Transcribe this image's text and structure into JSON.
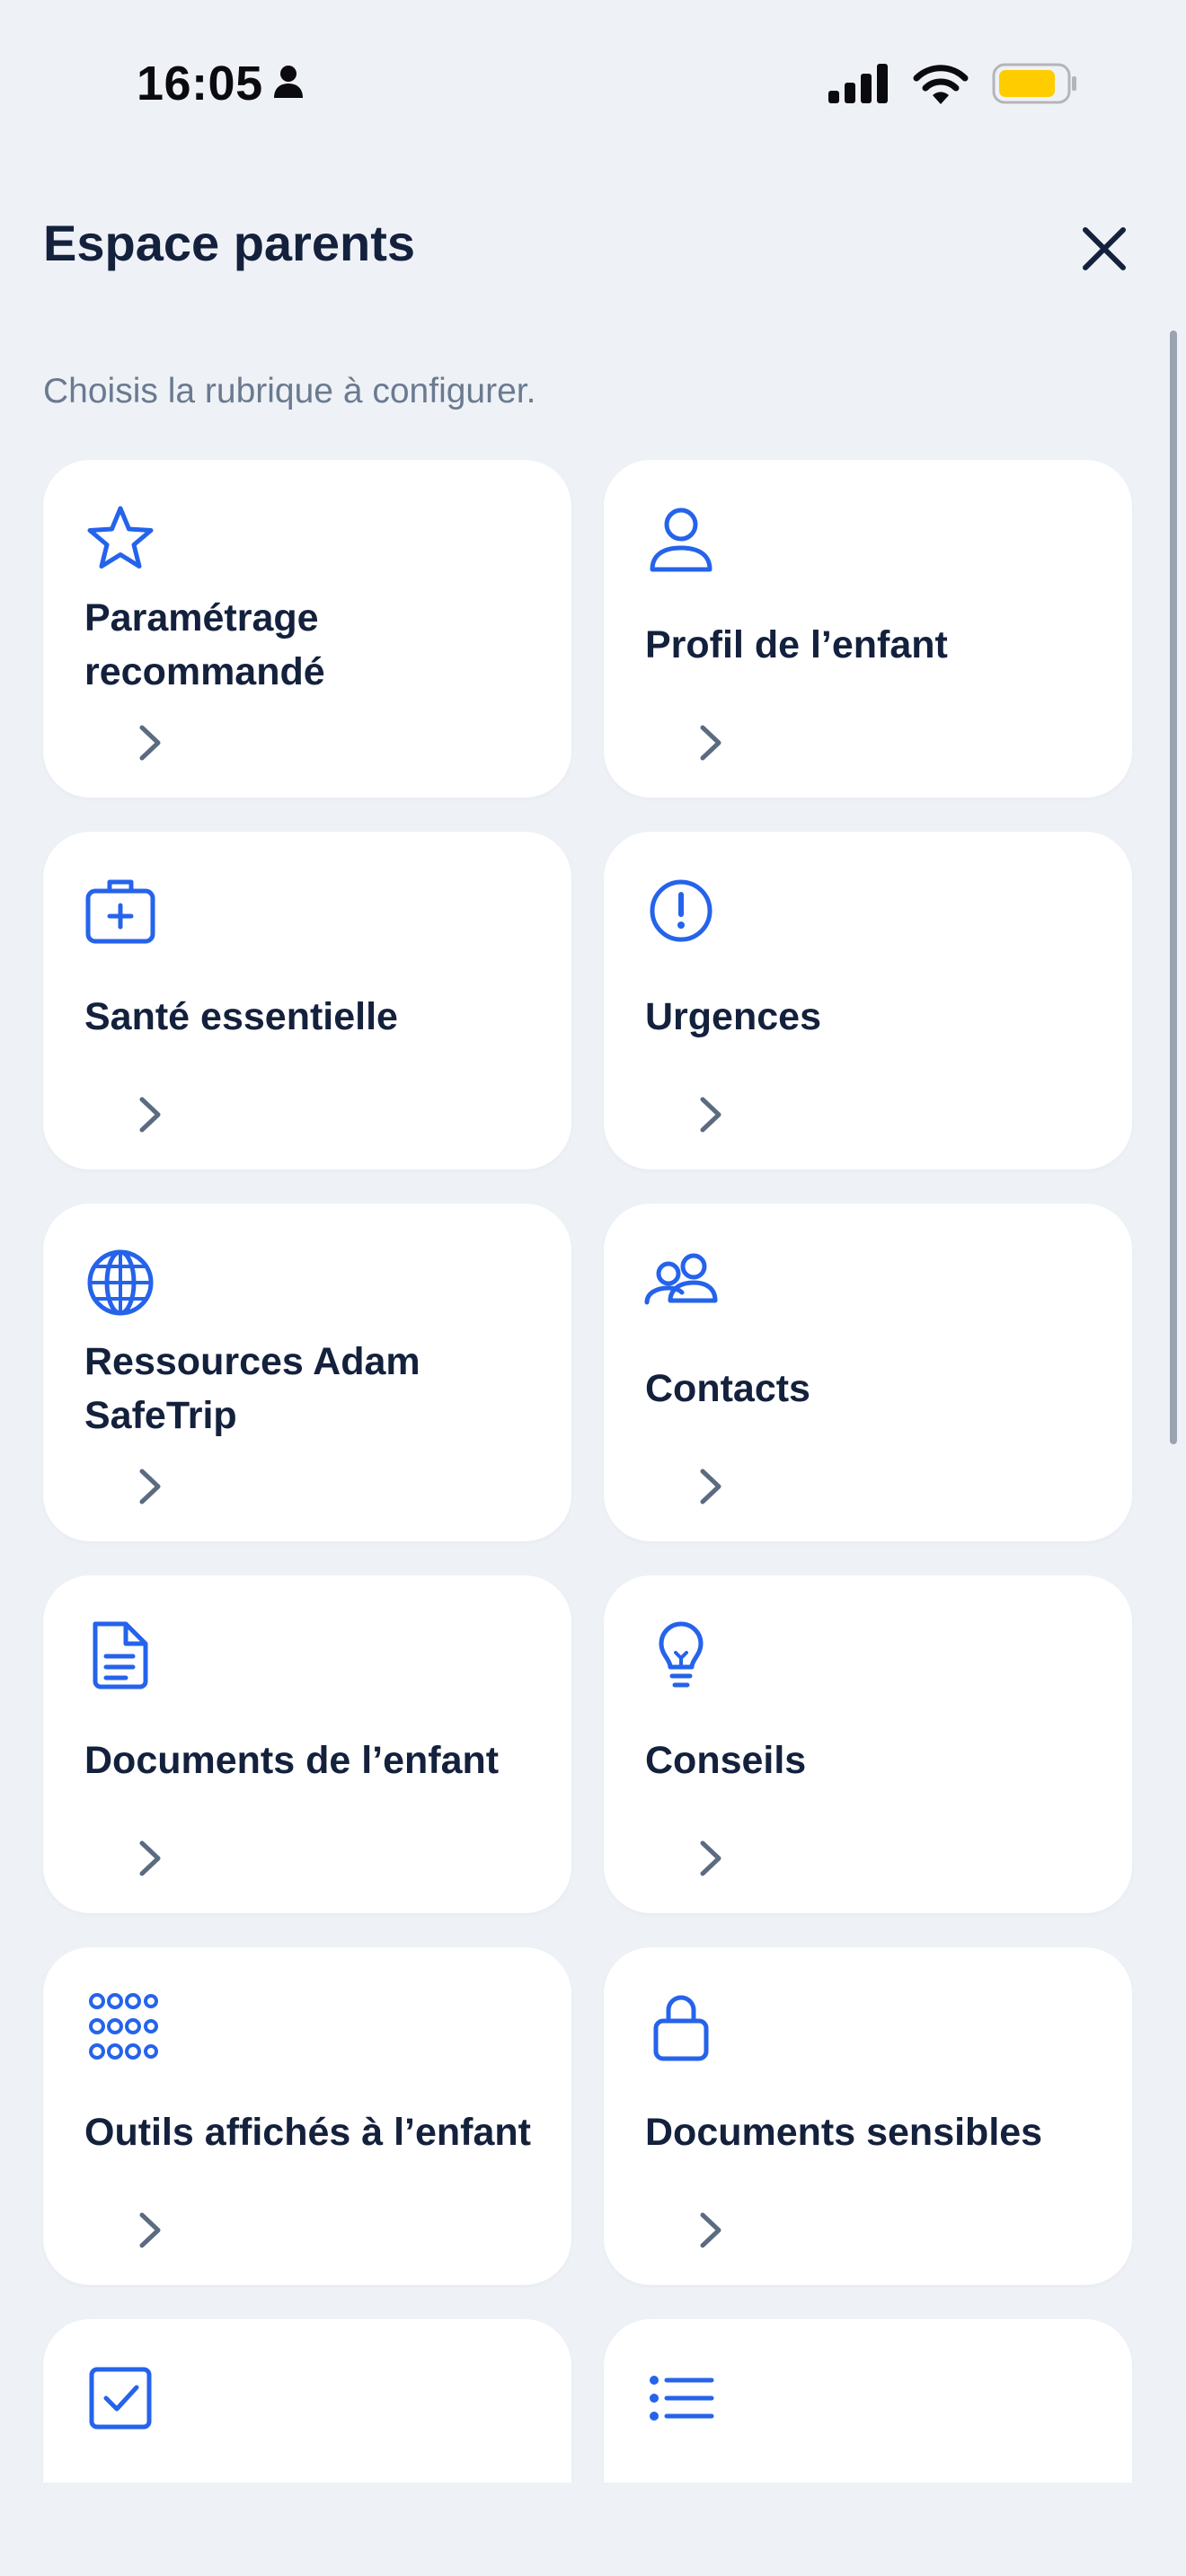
{
  "status_bar": {
    "time": "16:05",
    "icons": [
      "person-icon",
      "cellular-signal-icon",
      "wifi-icon",
      "battery-icon"
    ],
    "battery_color": "#FFCC00"
  },
  "header": {
    "title": "Espace parents",
    "close_icon": "close-icon"
  },
  "subtitle": "Choisis la rubrique à configurer.",
  "colors": {
    "accent": "#2563EB",
    "text_dark": "#14213D",
    "text_muted": "#6B7A90",
    "background": "#EEF2F7",
    "card": "#FFFFFF"
  },
  "cards": [
    {
      "label": "Paramétrage recommandé",
      "icon": "star-icon"
    },
    {
      "label": "Profil de l’enfant",
      "icon": "user-icon"
    },
    {
      "label": "Santé essentielle",
      "icon": "medical-kit-icon"
    },
    {
      "label": "Urgences",
      "icon": "alert-circle-icon"
    },
    {
      "label": "Ressources Adam SafeTrip",
      "icon": "globe-icon"
    },
    {
      "label": "Contacts",
      "icon": "users-icon"
    },
    {
      "label": "Documents de l’enfant",
      "icon": "document-icon"
    },
    {
      "label": "Conseils",
      "icon": "lightbulb-icon"
    },
    {
      "label": "Outils affichés à l’enfant",
      "icon": "grid-dots-icon"
    },
    {
      "label": "Documents sensibles",
      "icon": "lock-icon"
    },
    {
      "label": "",
      "icon": "checkbox-icon"
    },
    {
      "label": "",
      "icon": "list-icon"
    }
  ]
}
